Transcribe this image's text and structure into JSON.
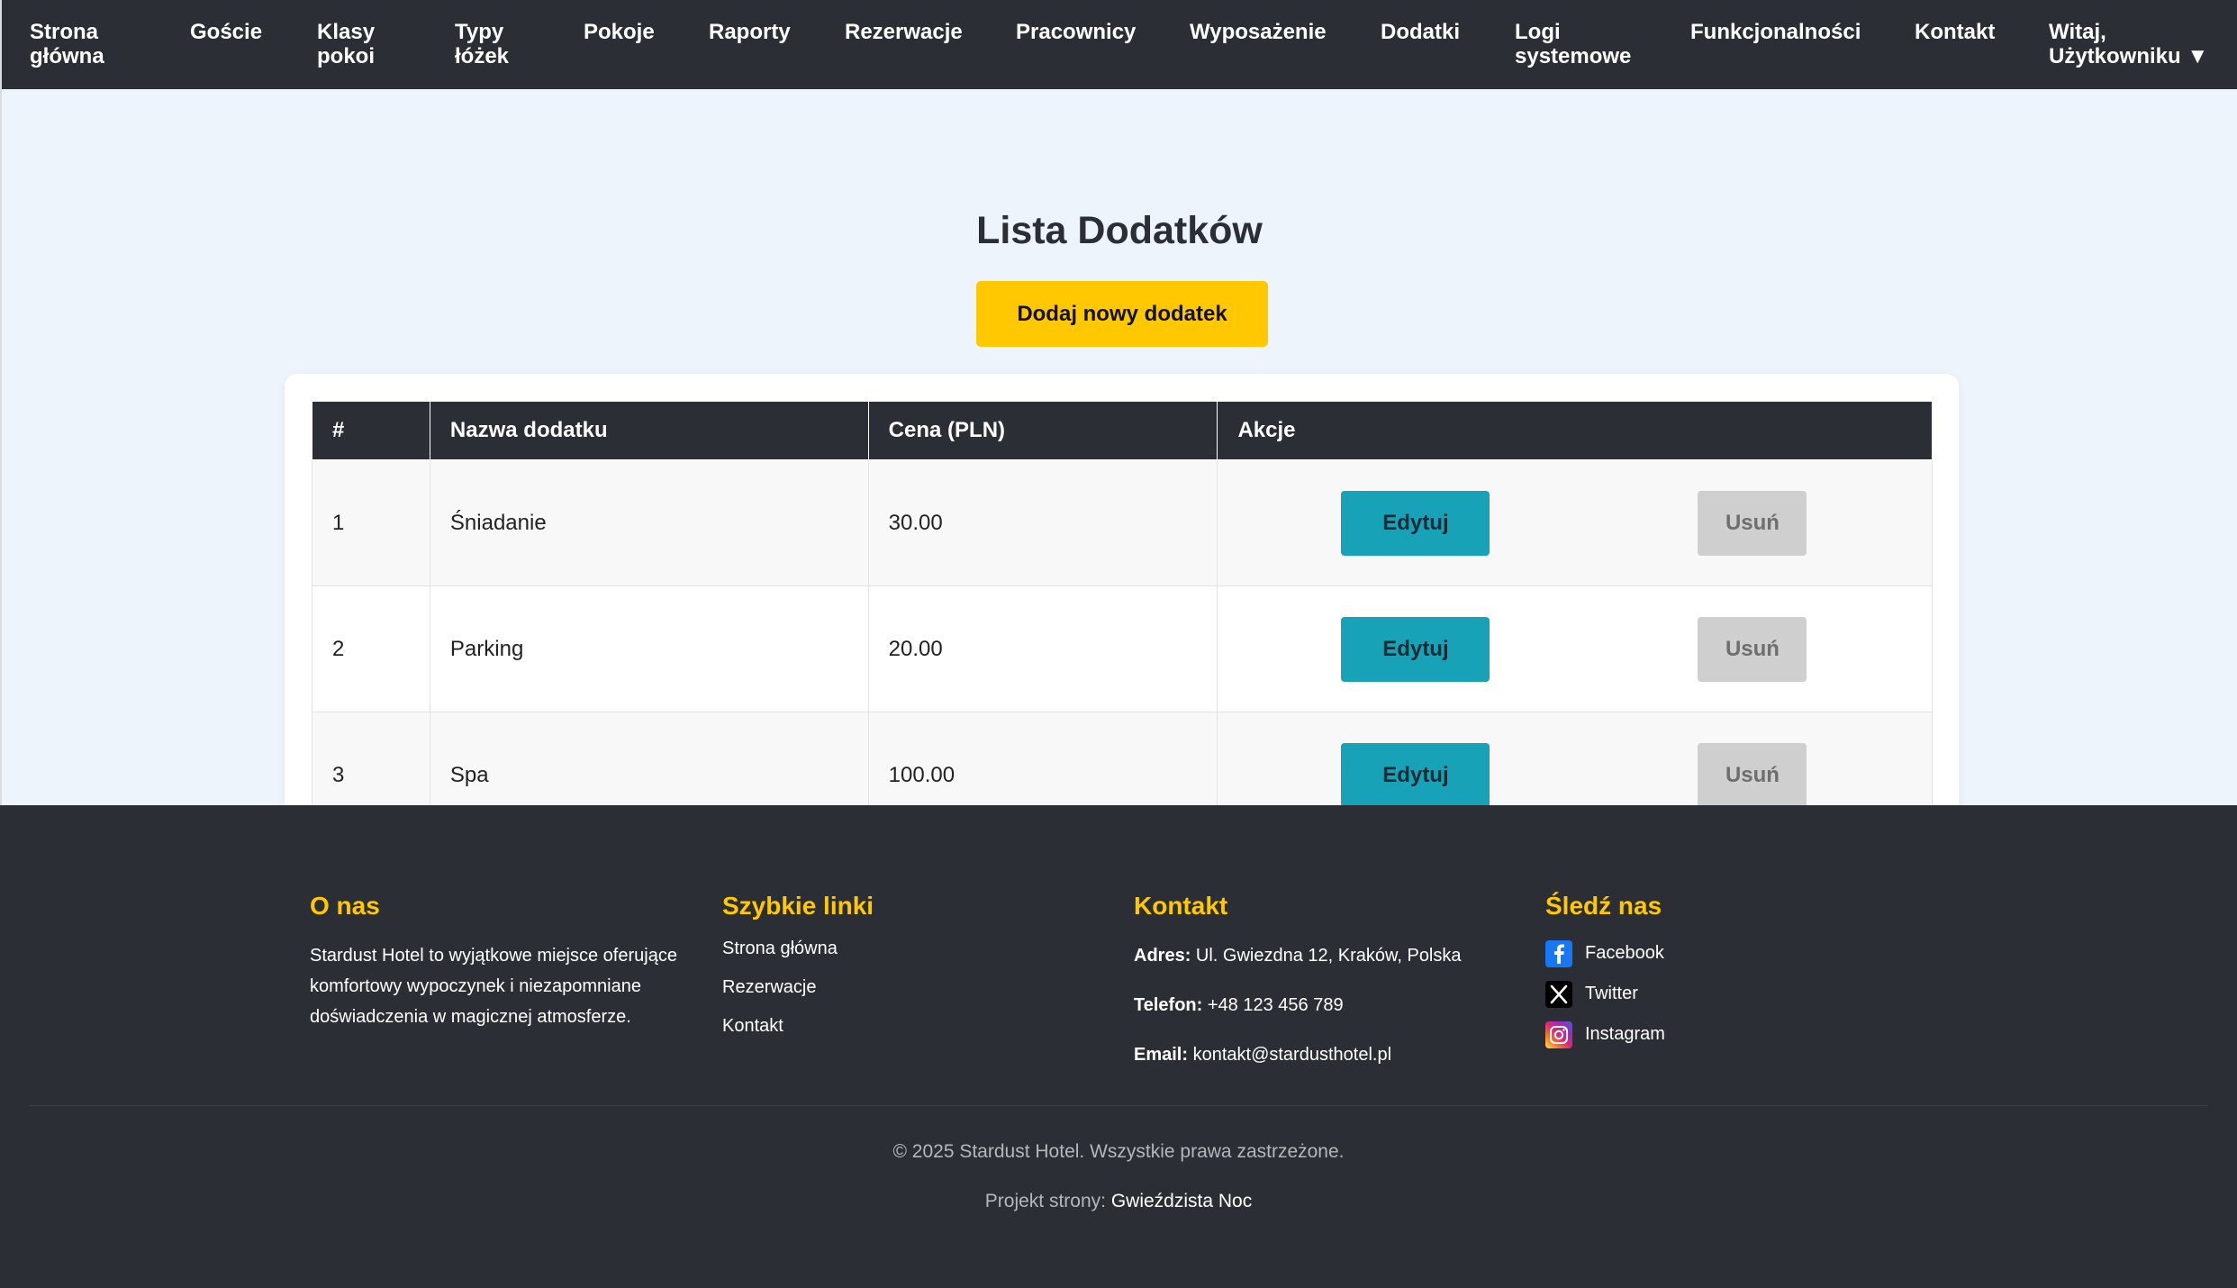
{
  "nav": {
    "items": [
      "Strona\ngłówna",
      "Goście",
      "Klasy\npokoi",
      "Typy\nłóżek",
      "Pokoje",
      "Raporty",
      "Rezerwacje",
      "Pracownicy",
      "Wyposażenie",
      "Dodatki",
      "Logi\nsystemowe",
      "Funkcjonalności",
      "Kontakt"
    ],
    "user_menu": "Witaj,\nUżytkowniku ▼"
  },
  "page": {
    "title": "Lista Dodatków",
    "add_button": "Dodaj nowy dodatek"
  },
  "table": {
    "headers": [
      "#",
      "Nazwa dodatku",
      "Cena (PLN)",
      "Akcje"
    ],
    "rows": [
      {
        "id": "1",
        "name": "Śniadanie",
        "price": "30.00",
        "edit": "Edytuj",
        "delete": "Usuń"
      },
      {
        "id": "2",
        "name": "Parking",
        "price": "20.00",
        "edit": "Edytuj",
        "delete": "Usuń"
      },
      {
        "id": "3",
        "name": "Spa",
        "price": "100.00",
        "edit": "Edytuj",
        "delete": "Usuń"
      }
    ]
  },
  "footer": {
    "about": {
      "heading": "O nas",
      "text": "Stardust Hotel to wyjątkowe miejsce oferujące komfortowy wypoczynek i niezapomniane doświadczenia w magicznej atmosferze."
    },
    "quick_links": {
      "heading": "Szybkie linki",
      "links": [
        "Strona główna",
        "Rezerwacje",
        "Kontakt"
      ]
    },
    "contact": {
      "heading": "Kontakt",
      "address_label": "Adres:",
      "address": "Ul. Gwiezdna 12, Kraków, Polska",
      "phone_label": "Telefon:",
      "phone": "+48 123 456 789",
      "email_label": "Email:",
      "email": "kontakt@stardusthotel.pl"
    },
    "follow": {
      "heading": "Śledź nas",
      "links": [
        {
          "label": "Facebook",
          "icon": "facebook-icon"
        },
        {
          "label": "Twitter",
          "icon": "x-twitter-icon"
        },
        {
          "label": "Instagram",
          "icon": "instagram-icon"
        }
      ]
    },
    "copyright": "© 2025 Stardust Hotel. Wszystkie prawa zastrzeżone.",
    "credit_prefix": "Projekt strony:",
    "credit_name": "Gwieździsta Noc"
  },
  "colors": {
    "nav_bg": "#2b2f35",
    "accent_yellow": "#ffc800",
    "edit_teal": "#17a2b8",
    "delete_gray": "#cfcfcf",
    "page_bg": "#eef4fb"
  }
}
